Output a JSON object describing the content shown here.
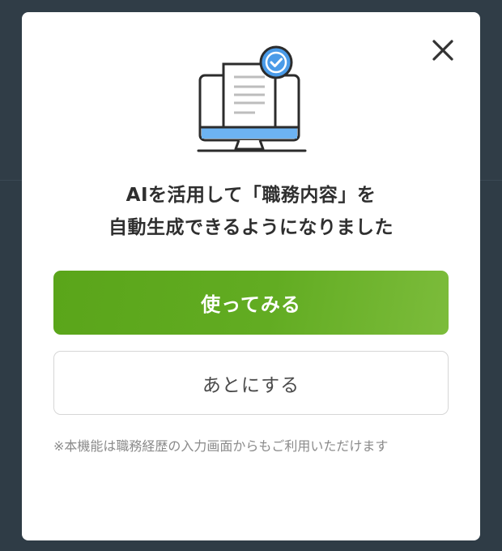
{
  "modal": {
    "close_label": "×",
    "headline_line1": "AIを活用して「職務内容」を",
    "headline_line2": "自動生成できるようになりました",
    "primary_button_label": "使ってみる",
    "secondary_button_label": "あとにする",
    "note": "※本機能は職務経歴の入力画面からもご利用いただけます"
  },
  "icons": {
    "close": "close-icon",
    "illustration": "monitor-document-check-icon"
  },
  "colors": {
    "overlay": "#2f3c46",
    "primary_button_start": "#5aa51a",
    "primary_button_end": "#7cbc3b",
    "check_badge": "#4a9be8",
    "screen_accent": "#6db3f2",
    "headline_text": "#2f2f2f",
    "note_text": "#8a8a8a"
  }
}
